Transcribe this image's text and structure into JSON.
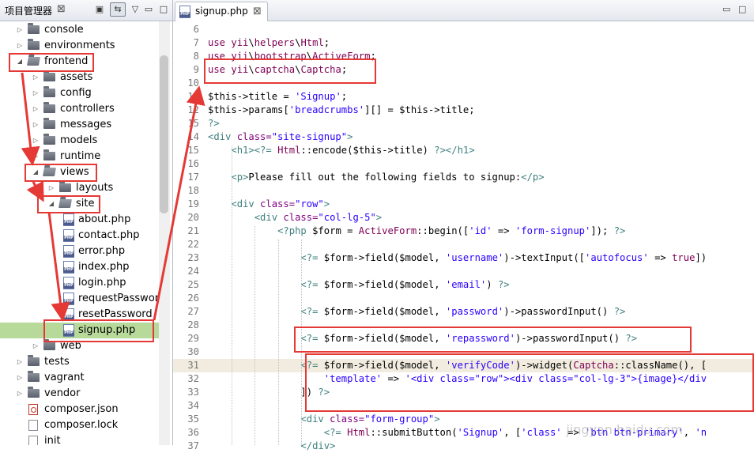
{
  "project_panel": {
    "title": "项目管理器",
    "tree": [
      {
        "label": "console",
        "type": "folder",
        "state": "collapsed",
        "depth": 1
      },
      {
        "label": "environments",
        "type": "folder",
        "state": "collapsed",
        "depth": 1
      },
      {
        "label": "frontend",
        "type": "folder",
        "state": "expanded",
        "depth": 1
      },
      {
        "label": "assets",
        "type": "folder",
        "state": "collapsed",
        "depth": 2
      },
      {
        "label": "config",
        "type": "folder",
        "state": "collapsed",
        "depth": 2
      },
      {
        "label": "controllers",
        "type": "folder",
        "state": "collapsed",
        "depth": 2
      },
      {
        "label": "messages",
        "type": "folder",
        "state": "collapsed",
        "depth": 2
      },
      {
        "label": "models",
        "type": "folder",
        "state": "collapsed",
        "depth": 2
      },
      {
        "label": "runtime",
        "type": "folder",
        "state": "collapsed",
        "depth": 2
      },
      {
        "label": "views",
        "type": "folder",
        "state": "expanded",
        "depth": 2
      },
      {
        "label": "layouts",
        "type": "folder",
        "state": "collapsed",
        "depth": 3
      },
      {
        "label": "site",
        "type": "folder",
        "state": "expanded",
        "depth": 3
      },
      {
        "label": "about.php",
        "type": "php",
        "depth": 4
      },
      {
        "label": "contact.php",
        "type": "php",
        "depth": 4
      },
      {
        "label": "error.php",
        "type": "php",
        "depth": 4
      },
      {
        "label": "index.php",
        "type": "php",
        "depth": 4
      },
      {
        "label": "login.php",
        "type": "php",
        "depth": 4
      },
      {
        "label": "requestPassword",
        "type": "php",
        "depth": 4
      },
      {
        "label": "resetPassword",
        "type": "php",
        "depth": 4
      },
      {
        "label": "signup.php",
        "type": "php",
        "depth": 4,
        "selected": true
      },
      {
        "label": "web",
        "type": "folder",
        "state": "collapsed",
        "depth": 2
      },
      {
        "label": "tests",
        "type": "folder",
        "state": "collapsed",
        "depth": 1
      },
      {
        "label": "vagrant",
        "type": "folder",
        "state": "collapsed",
        "depth": 1
      },
      {
        "label": "vendor",
        "type": "folder",
        "state": "collapsed",
        "depth": 1
      },
      {
        "label": "composer.json",
        "type": "composer",
        "depth": 1
      },
      {
        "label": "composer.lock",
        "type": "file",
        "depth": 1
      },
      {
        "label": "init",
        "type": "file",
        "depth": 1
      }
    ]
  },
  "editor": {
    "tab_label": "signup.php",
    "lines": [
      {
        "n": "6",
        "parts": []
      },
      {
        "n": "7",
        "parts": [
          [
            "kw",
            "use "
          ],
          [
            "ns",
            "yii"
          ],
          [
            "p",
            "\\"
          ],
          [
            "ns",
            "helpers"
          ],
          [
            "p",
            "\\"
          ],
          [
            "ns",
            "Html"
          ],
          [
            "p",
            ";"
          ]
        ]
      },
      {
        "n": "8",
        "parts": [
          [
            "kw",
            "use "
          ],
          [
            "ns",
            "yii"
          ],
          [
            "p",
            "\\"
          ],
          [
            "ns",
            "bootstrap"
          ],
          [
            "p",
            "\\"
          ],
          [
            "ns",
            "ActiveForm"
          ],
          [
            "p",
            ";"
          ]
        ]
      },
      {
        "n": "9",
        "parts": [
          [
            "kw",
            "use "
          ],
          [
            "ns",
            "yii"
          ],
          [
            "p",
            "\\"
          ],
          [
            "ns",
            "captcha"
          ],
          [
            "p",
            "\\"
          ],
          [
            "ns",
            "Captcha"
          ],
          [
            "p",
            ";"
          ]
        ]
      },
      {
        "n": "10",
        "parts": []
      },
      {
        "n": "11",
        "parts": [
          [
            "v",
            "$this"
          ],
          [
            "p",
            "->"
          ],
          [
            "t",
            "title = "
          ],
          [
            "s",
            "'Signup'"
          ],
          [
            "p",
            ";"
          ]
        ]
      },
      {
        "n": "12",
        "parts": [
          [
            "v",
            "$this"
          ],
          [
            "p",
            "->"
          ],
          [
            "t",
            "params["
          ],
          [
            "s",
            "'breadcrumbs'"
          ],
          [
            "t",
            "][] = "
          ],
          [
            "v",
            "$this"
          ],
          [
            "p",
            "->"
          ],
          [
            "t",
            "title;"
          ]
        ]
      },
      {
        "n": "15",
        "parts": [
          [
            "tag",
            "?>"
          ]
        ]
      },
      {
        "n": "14",
        "parts": [
          [
            "tag",
            "<div "
          ],
          [
            "attr",
            "class="
          ],
          [
            "s",
            "\"site-signup\""
          ],
          [
            "tag",
            ">"
          ]
        ]
      },
      {
        "n": "15",
        "parts": [
          [
            "i",
            "    "
          ],
          [
            "tag",
            "<h1>"
          ],
          [
            "tag",
            "<?= "
          ],
          [
            "cls",
            "Html"
          ],
          [
            "p",
            "::"
          ],
          [
            "t",
            "encode("
          ],
          [
            "v",
            "$this"
          ],
          [
            "p",
            "->"
          ],
          [
            "t",
            "title) "
          ],
          [
            "tag",
            "?></h1>"
          ]
        ]
      },
      {
        "n": "16",
        "parts": []
      },
      {
        "n": "17",
        "parts": [
          [
            "i",
            "    "
          ],
          [
            "tag",
            "<p>"
          ],
          [
            "t",
            "Please fill out the following fields to signup:"
          ],
          [
            "tag",
            "</p>"
          ]
        ]
      },
      {
        "n": "18",
        "parts": []
      },
      {
        "n": "19",
        "parts": [
          [
            "i",
            "    "
          ],
          [
            "tag",
            "<div "
          ],
          [
            "attr",
            "class="
          ],
          [
            "s",
            "\"row\""
          ],
          [
            "tag",
            ">"
          ]
        ]
      },
      {
        "n": "20",
        "parts": [
          [
            "i",
            "        "
          ],
          [
            "tag",
            "<div "
          ],
          [
            "attr",
            "class="
          ],
          [
            "s",
            "\"col-lg-5\""
          ],
          [
            "tag",
            ">"
          ]
        ]
      },
      {
        "n": "21",
        "parts": [
          [
            "i",
            "            "
          ],
          [
            "tag",
            "<?php "
          ],
          [
            "v",
            "$form"
          ],
          [
            "t",
            " = "
          ],
          [
            "cls",
            "ActiveForm"
          ],
          [
            "p",
            "::"
          ],
          [
            "t",
            "begin(["
          ],
          [
            "s",
            "'id'"
          ],
          [
            "t",
            " => "
          ],
          [
            "s",
            "'form-signup'"
          ],
          [
            "t",
            "]); "
          ],
          [
            "tag",
            "?>"
          ]
        ]
      },
      {
        "n": "22",
        "parts": []
      },
      {
        "n": "23",
        "parts": [
          [
            "i",
            "                "
          ],
          [
            "tag",
            "<?= "
          ],
          [
            "v",
            "$form"
          ],
          [
            "p",
            "->"
          ],
          [
            "t",
            "field("
          ],
          [
            "v",
            "$model"
          ],
          [
            "t",
            ", "
          ],
          [
            "s",
            "'username'"
          ],
          [
            "t",
            ")"
          ],
          [
            "p",
            "->"
          ],
          [
            "t",
            "textInput(["
          ],
          [
            "s",
            "'autofocus'"
          ],
          [
            "t",
            " => "
          ],
          [
            "kw",
            "true"
          ],
          [
            "t",
            "])"
          ]
        ]
      },
      {
        "n": "24",
        "parts": []
      },
      {
        "n": "25",
        "parts": [
          [
            "i",
            "                "
          ],
          [
            "tag",
            "<?= "
          ],
          [
            "v",
            "$form"
          ],
          [
            "p",
            "->"
          ],
          [
            "t",
            "field("
          ],
          [
            "v",
            "$model"
          ],
          [
            "t",
            ", "
          ],
          [
            "s",
            "'email'"
          ],
          [
            "t",
            ") "
          ],
          [
            "tag",
            "?>"
          ]
        ]
      },
      {
        "n": "26",
        "parts": []
      },
      {
        "n": "27",
        "parts": [
          [
            "i",
            "                "
          ],
          [
            "tag",
            "<?= "
          ],
          [
            "v",
            "$form"
          ],
          [
            "p",
            "->"
          ],
          [
            "t",
            "field("
          ],
          [
            "v",
            "$model"
          ],
          [
            "t",
            ", "
          ],
          [
            "s",
            "'password'"
          ],
          [
            "t",
            ")"
          ],
          [
            "p",
            "->"
          ],
          [
            "t",
            "passwordInput() "
          ],
          [
            "tag",
            "?>"
          ]
        ]
      },
      {
        "n": "28",
        "parts": []
      },
      {
        "n": "29",
        "parts": [
          [
            "i",
            "                "
          ],
          [
            "tag",
            "<?= "
          ],
          [
            "v",
            "$form"
          ],
          [
            "p",
            "->"
          ],
          [
            "t",
            "field("
          ],
          [
            "v",
            "$model"
          ],
          [
            "t",
            ", "
          ],
          [
            "s",
            "'repassword'"
          ],
          [
            "t",
            ")"
          ],
          [
            "p",
            "->"
          ],
          [
            "t",
            "passwordInput() "
          ],
          [
            "tag",
            "?>"
          ]
        ]
      },
      {
        "n": "30",
        "parts": []
      },
      {
        "n": "31",
        "parts": [
          [
            "i",
            "                "
          ],
          [
            "tag",
            "<?= "
          ],
          [
            "v",
            "$form"
          ],
          [
            "p",
            "->"
          ],
          [
            "t",
            "field("
          ],
          [
            "v",
            "$model"
          ],
          [
            "t",
            ", "
          ],
          [
            "s",
            "'verifyCode'"
          ],
          [
            "t",
            ")"
          ],
          [
            "p",
            "->"
          ],
          [
            "t",
            "widget("
          ],
          [
            "cls",
            "Captcha"
          ],
          [
            "p",
            "::"
          ],
          [
            "t",
            "className(), ["
          ]
        ]
      },
      {
        "n": "32",
        "parts": [
          [
            "i",
            "                    "
          ],
          [
            "s",
            "'template'"
          ],
          [
            "t",
            " => "
          ],
          [
            "s",
            "'<div class=\"row\"><div class=\"col-lg-3\">{image}</div"
          ]
        ]
      },
      {
        "n": "33",
        "parts": [
          [
            "i",
            "                "
          ],
          [
            "t",
            "]) "
          ],
          [
            "tag",
            "?>"
          ]
        ]
      },
      {
        "n": "34",
        "parts": []
      },
      {
        "n": "35",
        "parts": [
          [
            "i",
            "                "
          ],
          [
            "tag",
            "<div "
          ],
          [
            "attr",
            "class="
          ],
          [
            "s",
            "\"form-group\""
          ],
          [
            "tag",
            ">"
          ]
        ]
      },
      {
        "n": "36",
        "parts": [
          [
            "i",
            "                    "
          ],
          [
            "tag",
            "<?= "
          ],
          [
            "cls",
            "Html"
          ],
          [
            "p",
            "::"
          ],
          [
            "t",
            "submitButton("
          ],
          [
            "s",
            "'Signup'"
          ],
          [
            "t",
            ", ["
          ],
          [
            "s",
            "'class'"
          ],
          [
            "t",
            " => "
          ],
          [
            "s",
            "'btn btn-primary'"
          ],
          [
            "t",
            ", "
          ],
          [
            "s",
            "'n"
          ]
        ]
      },
      {
        "n": "37",
        "parts": [
          [
            "i",
            "                "
          ],
          [
            "tag",
            "</div>"
          ]
        ]
      }
    ]
  },
  "watermark": "jingyan.baidu.com",
  "colors": {
    "highlight": "#e53935",
    "keyword": "#7f0055",
    "namespace": "#7f0055",
    "string": "#2a00ff",
    "variable": "#000000",
    "tag": "#3f7f7f",
    "attr": "#7f007f",
    "class": "#7f0055",
    "selected_row": "#b7d99a",
    "current_line": "#f1ecdf"
  }
}
